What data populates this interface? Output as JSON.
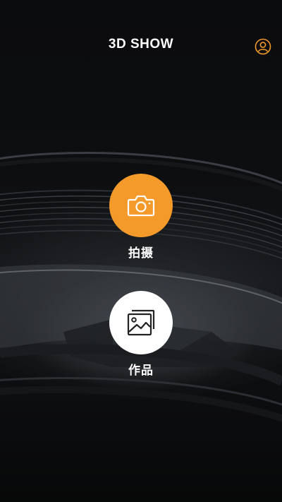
{
  "header": {
    "title": "3D SHOW",
    "profile_icon": "user-profile-icon"
  },
  "actions": {
    "shoot": {
      "label": "拍摄",
      "icon": "camera-icon"
    },
    "works": {
      "label": "作品",
      "icon": "gallery-icon"
    }
  },
  "colors": {
    "accent": "#f39a2b",
    "background": "#0a0b0d",
    "text": "#ffffff",
    "secondary_button": "#ffffff"
  }
}
